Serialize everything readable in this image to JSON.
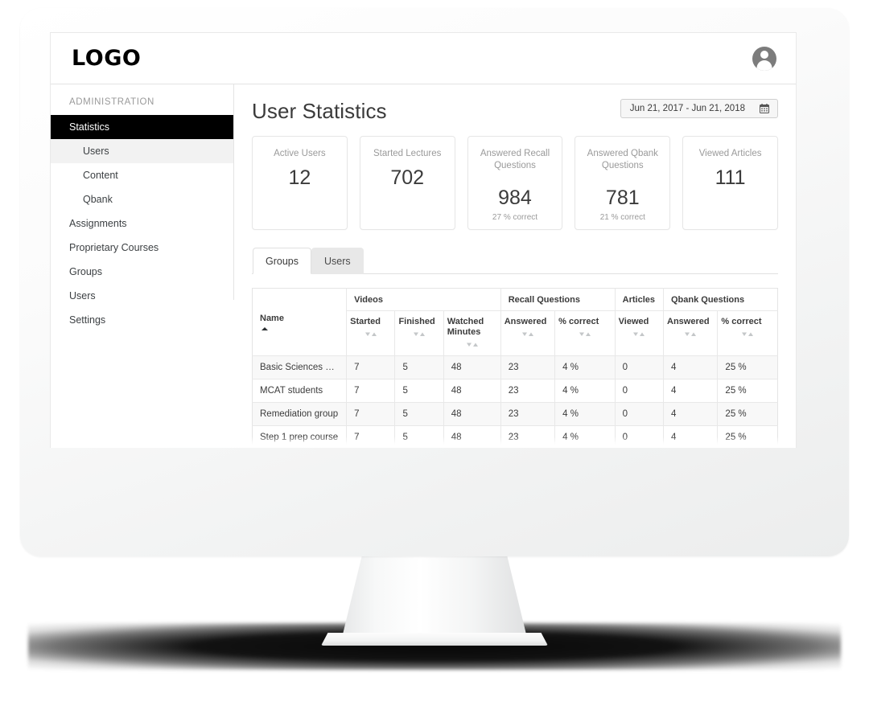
{
  "navbar": {
    "logo_text": "LOGO",
    "avatar_icon": "user-avatar-icon"
  },
  "sidebar": {
    "section_label": "ADMINISTRATION",
    "items": [
      {
        "label": "Statistics",
        "state": "active",
        "level": 0
      },
      {
        "label": "Users",
        "state": "current",
        "level": 1
      },
      {
        "label": "Content",
        "state": "normal",
        "level": 1
      },
      {
        "label": "Qbank",
        "state": "normal",
        "level": 1
      },
      {
        "label": "Assignments",
        "state": "normal",
        "level": 0
      },
      {
        "label": "Proprietary Courses",
        "state": "normal",
        "level": 0
      },
      {
        "label": "Groups",
        "state": "normal",
        "level": 0
      },
      {
        "label": "Users",
        "state": "normal",
        "level": 0
      },
      {
        "label": "Settings",
        "state": "normal",
        "level": 0
      }
    ]
  },
  "main": {
    "page_title": "User Statistics",
    "date_range": {
      "value": "Jun 21, 2017 - Jun 21, 2018",
      "icon": "calendar-icon"
    },
    "cards": [
      {
        "label": "Active Users",
        "value": "12",
        "sub": ""
      },
      {
        "label": "Started Lectures",
        "value": "702",
        "sub": ""
      },
      {
        "label": "Answered Recall Questions",
        "value": "984",
        "sub": "27 % correct"
      },
      {
        "label": "Answered Qbank Questions",
        "value": "781",
        "sub": "21 % correct"
      },
      {
        "label": "Viewed Articles",
        "value": "111",
        "sub": ""
      }
    ],
    "tabs": [
      {
        "label": "Groups",
        "active": true
      },
      {
        "label": "Users",
        "active": false
      }
    ],
    "table": {
      "group_headers": [
        {
          "label": "Videos",
          "span": 3
        },
        {
          "label": "Recall Questions",
          "span": 2
        },
        {
          "label": "Articles",
          "span": 1
        },
        {
          "label": "Qbank Questions",
          "span": 2
        }
      ],
      "name_column": {
        "label": "Name",
        "sort": "asc"
      },
      "sub_headers": [
        {
          "label": "Started",
          "sortable": true
        },
        {
          "label": "Finished",
          "sortable": true
        },
        {
          "label": "Watched Minutes",
          "sortable": true
        },
        {
          "label": "Answered",
          "sortable": true
        },
        {
          "label": "% correct",
          "sortable": true
        },
        {
          "label": "Viewed",
          "sortable": true
        },
        {
          "label": "Answered",
          "sortable": true
        },
        {
          "label": "% correct",
          "sortable": true
        }
      ],
      "rows": [
        {
          "name": "Basic Sciences Flippe...",
          "cells": [
            "7",
            "5",
            "48",
            "23",
            "4 %",
            "0",
            "4",
            "25 %"
          ]
        },
        {
          "name": "MCAT students",
          "cells": [
            "7",
            "5",
            "48",
            "23",
            "4 %",
            "0",
            "4",
            "25 %"
          ]
        },
        {
          "name": "Remediation group",
          "cells": [
            "7",
            "5",
            "48",
            "23",
            "4 %",
            "0",
            "4",
            "25 %"
          ]
        },
        {
          "name": "Step 1 prep course",
          "cells": [
            "7",
            "5",
            "48",
            "23",
            "4 %",
            "0",
            "4",
            "25 %"
          ]
        }
      ]
    }
  },
  "colors": {
    "active_nav_bg": "#000000",
    "text_primary": "#3b3b3b",
    "text_muted": "#9a9a9a",
    "border": "#e4e4e4",
    "row_stripe": "#f8f8f8",
    "tab_inactive_bg": "#e8e8e8"
  }
}
